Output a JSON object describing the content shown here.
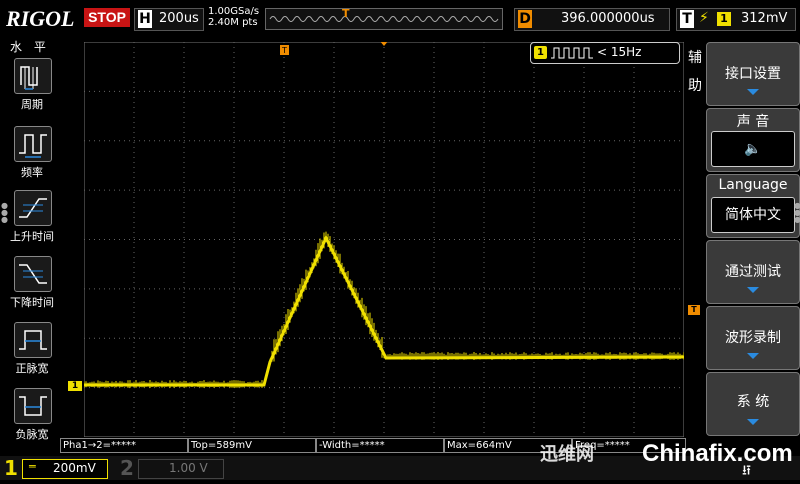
{
  "topbar": {
    "logo": "RIGOL",
    "run_state": "STOP",
    "horizontal_letter": "H",
    "timebase": "200us",
    "sample_rate": "1.00GSa/s",
    "memory_depth": "2.40M pts",
    "delay_letter": "D",
    "delay": "396.000000us",
    "trigger_letter": "T",
    "trigger_source": "1",
    "trigger_level": "312mV"
  },
  "left_menu": {
    "title": "水 平",
    "items": [
      {
        "label": "周期",
        "icon": "period-icon"
      },
      {
        "label": "频率",
        "icon": "frequency-icon"
      },
      {
        "label": "上升时间",
        "icon": "rise-time-icon"
      },
      {
        "label": "下降时间",
        "icon": "fall-time-icon"
      },
      {
        "label": "正脉宽",
        "icon": "positive-width-icon"
      },
      {
        "label": "负脉宽",
        "icon": "negative-width-icon"
      }
    ]
  },
  "right_menu": {
    "caption": "辅助",
    "items": [
      {
        "label": "接口设置"
      },
      {
        "label": "声 音",
        "value_icon": "speaker-icon"
      },
      {
        "label": "Language",
        "value": "简体中文"
      },
      {
        "label": "通过测试"
      },
      {
        "label": "波形录制"
      },
      {
        "label": "系 统"
      }
    ]
  },
  "freq_counter": {
    "channel": "1",
    "text": "< 15Hz"
  },
  "measurements": [
    "Pha1→2=*****",
    "Top=589mV",
    "-Width=*****",
    "Max=664mV",
    "Freq=*****"
  ],
  "channels": [
    {
      "num": "1",
      "scale": "200mV",
      "coupling": "═"
    },
    {
      "num": "2",
      "scale": "1.00 V"
    }
  ],
  "watermark": {
    "cn": "迅维网",
    "en": "Chinafix.com"
  },
  "trace": {
    "color": "#f0e000",
    "ground_marker": "1"
  },
  "colors": {
    "ch1": "#f0e000",
    "trigger": "#f08c00",
    "stop": "#c81414",
    "menu_arrow": "#2a8be0"
  }
}
